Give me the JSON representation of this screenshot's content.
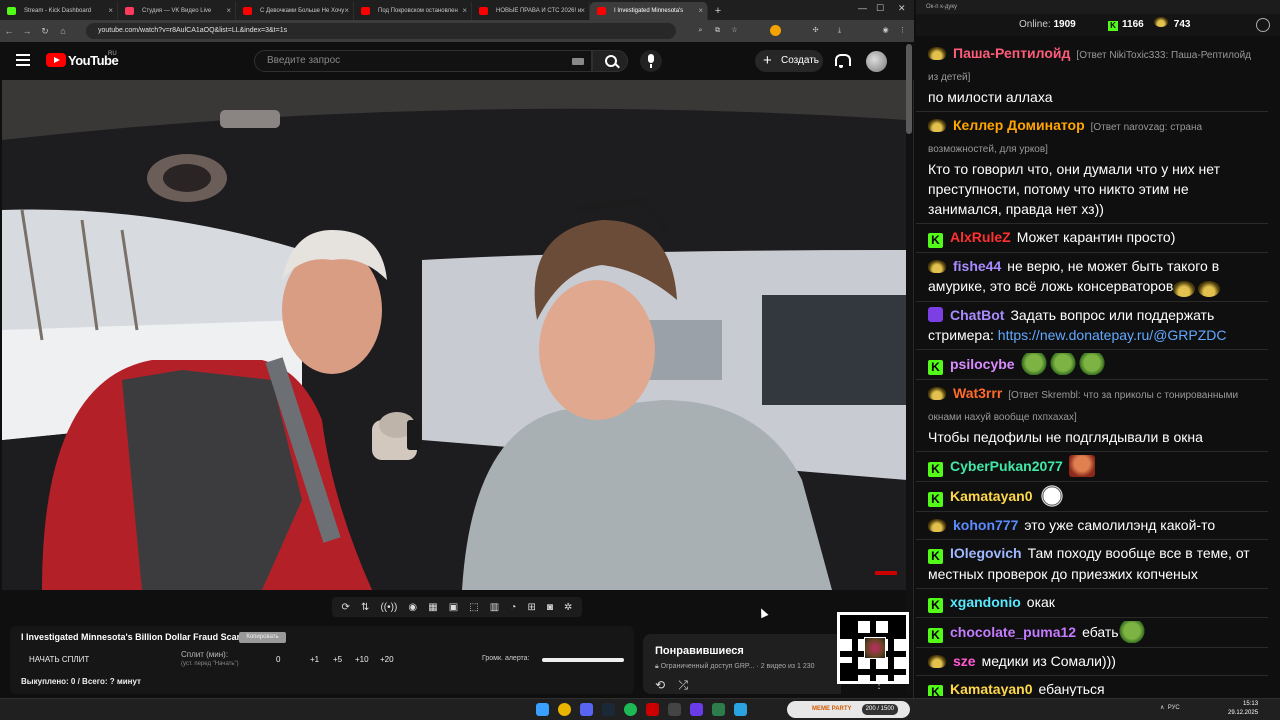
{
  "browser": {
    "tabs": [
      {
        "title": "Stream - Kick Dashboard",
        "fav_color": "#53fc18",
        "active": false
      },
      {
        "title": "Студия — VK Видео Live",
        "fav_color": "#ff3a5c",
        "active": false
      },
      {
        "title": "С Девочками Больше Не Хочу",
        "fav_color": "#ff0000",
        "active": false
      },
      {
        "title": "Под Покровском остановлен",
        "fav_color": "#ff0000",
        "active": false
      },
      {
        "title": "НОВЫЕ ПРАВА И СТС 2026! и",
        "fav_color": "#ff0000",
        "active": false
      },
      {
        "title": "I Investigated Minnesota's",
        "fav_color": "#ff0000",
        "active": true
      }
    ],
    "url": "youtube.com/watch?v=r8AulCA1aOQ&list=LL&index=3&t=1s"
  },
  "youtube": {
    "logo_text": "YouTube",
    "region": "RU",
    "search_placeholder": "Введите запрос",
    "create_label": "Создать"
  },
  "overlay": {
    "title": "I Investigated Minnesota's Billion Dollar Fraud Scandal",
    "chip": "Копировать",
    "start_split": "НАЧАТЬ СПЛИТ",
    "split_label": "Сплит (мин):",
    "split_hint": "(уст. перед \"Начать\")",
    "split_values": [
      "0",
      "+1",
      "+5",
      "+10",
      "+20"
    ],
    "volume_label": "Громк. алерта:",
    "bought": "Выкуплено: 0 / Всего: ? минут"
  },
  "liked": {
    "title": "Понравившиеся",
    "subtitle": "Ограниченный доступ GRP... · 2 видео из 1 230"
  },
  "chat": {
    "window_title": "Ок-п к-дуку",
    "online_label": "Online:",
    "online_count": "1909",
    "kick_count": "1166",
    "yt_count": "743",
    "messages": [
      {
        "badge": "yt",
        "nick": "Паша-Рептилойд",
        "color": "#ff5c7a",
        "reply": "[Ответ NikiToxic333: Паша-Рептилойд из детей]",
        "text": "по милости аллаха"
      },
      {
        "badge": "yt",
        "nick": "Келлер Доминатор",
        "color": "#ffa500",
        "reply": "[Ответ narovzag: страна возможностей, для урков]",
        "text": "Кто то говорил что, они думали что у них нет преступности, потому что никто этим не занимался, правда нет хз))"
      },
      {
        "badge": "kick",
        "nick": "AlxRuleZ",
        "color": "#ff3030",
        "reply": "",
        "text": "Может карантин просто)"
      },
      {
        "badge": "yt",
        "nick": "fishe44",
        "color": "#a88cff",
        "reply": "",
        "text": "не верю, не может быть такого в амурике, это всё ложь консерваторов",
        "emotes": [
          "gold",
          "gold"
        ]
      },
      {
        "badge": "bot",
        "nick": "ChatBot",
        "color": "#a88cff",
        "reply": "",
        "text": "Задать вопрос или поддержать стримера:",
        "link": "https://new.donatepay.ru/@GRPZDC"
      },
      {
        "badge": "kick",
        "nick": "psilocybe",
        "color": "#d98cff",
        "reply": "",
        "text": "",
        "emotes": [
          "pepe",
          "pepe",
          "pepe"
        ]
      },
      {
        "badge": "yt",
        "nick": "Wat3rrr",
        "color": "#ff6a2a",
        "reply": "[Ответ Skrembl: что за приколы с тонированными окнами нахуй вообще пхпхахах]",
        "text": "Чтобы педофилы не подглядывали в окна"
      },
      {
        "badge": "kick",
        "nick": "CyberPukan2077",
        "color": "#42e8a8",
        "reply": "",
        "text": "",
        "emotes": [
          "face"
        ]
      },
      {
        "badge": "kick",
        "nick": "Kamatayan0",
        "color": "#ffd84a",
        "reply": "",
        "text": "",
        "emotes": [
          "troll"
        ]
      },
      {
        "badge": "yt",
        "nick": "kohon777",
        "color": "#5a8cff",
        "reply": "",
        "text": "это уже самолилэнд какой-то"
      },
      {
        "badge": "kick",
        "nick": "IOlegovich",
        "color": "#9fb8ff",
        "reply": "",
        "text": "Там походу вообще все в теме, от местных проверок до приезжих копченых"
      },
      {
        "badge": "kick",
        "nick": "xgandonio",
        "color": "#58e8ff",
        "reply": "",
        "text": "окак"
      },
      {
        "badge": "kick",
        "nick": "chocolate_puma12",
        "color": "#c57cff",
        "reply": "",
        "text": "ебать",
        "emotes": [
          "pepe"
        ]
      },
      {
        "badge": "yt",
        "nick": "sze",
        "color": "#ff5ad0",
        "reply": "",
        "text": "медики из Сомали)))"
      },
      {
        "badge": "kick",
        "nick": "Kamatayan0",
        "color": "#ffd84a",
        "reply": "",
        "text": "ебануться"
      }
    ]
  },
  "taskbar": {
    "meme_label": "MEME PARTY",
    "meme_progress": "200 / 1500",
    "lang": "РУС",
    "time": "15:13",
    "date": "29.12.2025"
  }
}
